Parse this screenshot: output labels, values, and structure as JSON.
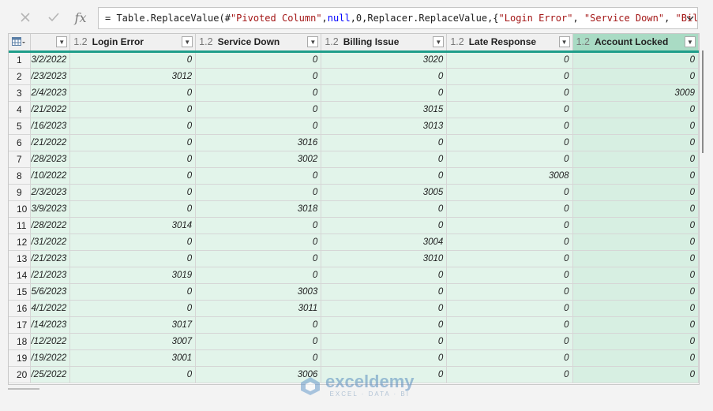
{
  "formula_bar": {
    "cancel_icon": "close-x-icon",
    "confirm_icon": "checkmark-icon",
    "fx_label": "fx",
    "formula_parts": {
      "p1": "= Table.ReplaceValue(#",
      "p2": "\"Pivoted Column\"",
      "p3": ",",
      "p4": "null",
      "p5": ",0,Replacer.ReplaceValue,{",
      "p6": "\"Login Error\"",
      "p7": ", ",
      "p8": "\"Service Down\"",
      "p9": ", ",
      "p10": "\"Billing"
    },
    "expand_icon": "chevron-down-icon"
  },
  "table": {
    "type_label": "1.2",
    "columns": [
      {
        "name": "Login Error"
      },
      {
        "name": "Service Down"
      },
      {
        "name": "Billing Issue"
      },
      {
        "name": "Late Response"
      },
      {
        "name": "Account Locked"
      }
    ],
    "rows": [
      {
        "n": "1",
        "date": "3/2/2022",
        "v": [
          "0",
          "0",
          "3020",
          "0",
          "0"
        ]
      },
      {
        "n": "2",
        "date": "/23/2023",
        "v": [
          "3012",
          "0",
          "0",
          "0",
          "0"
        ]
      },
      {
        "n": "3",
        "date": "2/4/2023",
        "v": [
          "0",
          "0",
          "0",
          "0",
          "3009"
        ]
      },
      {
        "n": "4",
        "date": "/21/2022",
        "v": [
          "0",
          "0",
          "3015",
          "0",
          "0"
        ]
      },
      {
        "n": "5",
        "date": "/16/2023",
        "v": [
          "0",
          "0",
          "3013",
          "0",
          "0"
        ]
      },
      {
        "n": "6",
        "date": "/21/2022",
        "v": [
          "0",
          "3016",
          "0",
          "0",
          "0"
        ]
      },
      {
        "n": "7",
        "date": "/28/2023",
        "v": [
          "0",
          "3002",
          "0",
          "0",
          "0"
        ]
      },
      {
        "n": "8",
        "date": "/10/2022",
        "v": [
          "0",
          "0",
          "0",
          "3008",
          "0"
        ]
      },
      {
        "n": "9",
        "date": "2/3/2023",
        "v": [
          "0",
          "0",
          "3005",
          "0",
          "0"
        ]
      },
      {
        "n": "10",
        "date": "3/9/2023",
        "v": [
          "0",
          "3018",
          "0",
          "0",
          "0"
        ]
      },
      {
        "n": "11",
        "date": "/28/2022",
        "v": [
          "3014",
          "0",
          "0",
          "0",
          "0"
        ]
      },
      {
        "n": "12",
        "date": "/31/2022",
        "v": [
          "0",
          "0",
          "3004",
          "0",
          "0"
        ]
      },
      {
        "n": "13",
        "date": "/21/2023",
        "v": [
          "0",
          "0",
          "3010",
          "0",
          "0"
        ]
      },
      {
        "n": "14",
        "date": "/21/2023",
        "v": [
          "3019",
          "0",
          "0",
          "0",
          "0"
        ]
      },
      {
        "n": "15",
        "date": "5/6/2023",
        "v": [
          "0",
          "3003",
          "0",
          "0",
          "0"
        ]
      },
      {
        "n": "16",
        "date": "4/1/2022",
        "v": [
          "0",
          "3011",
          "0",
          "0",
          "0"
        ]
      },
      {
        "n": "17",
        "date": "/14/2023",
        "v": [
          "3017",
          "0",
          "0",
          "0",
          "0"
        ]
      },
      {
        "n": "18",
        "date": "/12/2022",
        "v": [
          "3007",
          "0",
          "0",
          "0",
          "0"
        ]
      },
      {
        "n": "19",
        "date": "/19/2022",
        "v": [
          "3001",
          "0",
          "0",
          "0",
          "0"
        ]
      },
      {
        "n": "20",
        "date": "/25/2022",
        "v": [
          "0",
          "3006",
          "0",
          "0",
          "0"
        ]
      }
    ]
  },
  "watermark": {
    "brand": "exceldemy",
    "tagline": "EXCEL · DATA · BI"
  },
  "colors": {
    "accent_teal": "#1f9e8a",
    "cell_green": "#e2f4ea",
    "selected_header": "#a9dbc4"
  }
}
